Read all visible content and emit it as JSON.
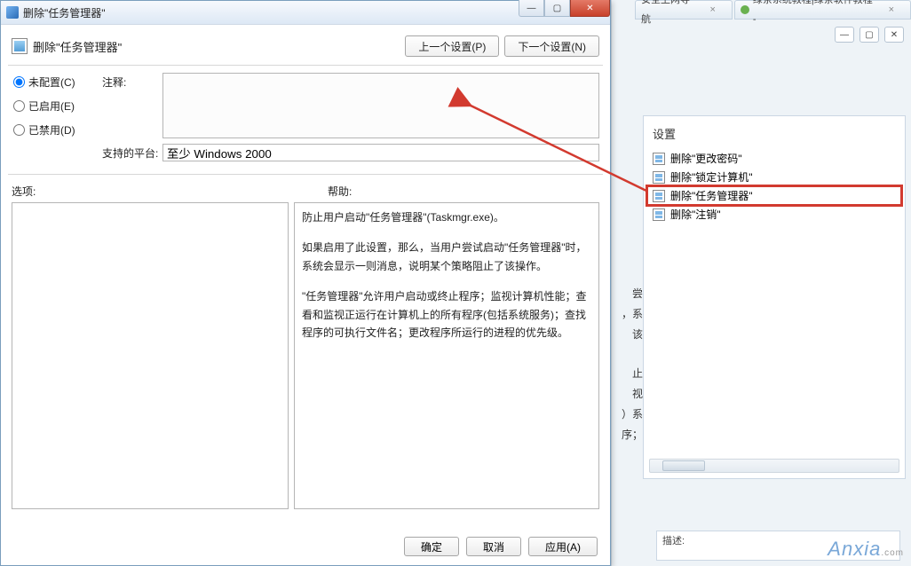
{
  "dialog": {
    "title": "删除\"任务管理器\"",
    "header_title": "删除\"任务管理器\"",
    "nav_prev": "上一个设置(P)",
    "nav_next": "下一个设置(N)",
    "radios": {
      "unconfigured": "未配置(C)",
      "enabled": "已启用(E)",
      "disabled": "已禁用(D)"
    },
    "comment_label": "注释:",
    "comment_value": "",
    "platform_label": "支持的平台:",
    "platform_value": "至少 Windows 2000",
    "options_label": "选项:",
    "help_label": "帮助:",
    "help_body": {
      "p1": "防止用户启动\"任务管理器\"(Taskmgr.exe)。",
      "p2": "如果启用了此设置，那么，当用户尝试启动\"任务管理器\"时，系统会显示一则消息，说明某个策略阻止了该操作。",
      "p3": "\"任务管理器\"允许用户启动或终止程序；监视计算机性能；查看和监视正运行在计算机上的所有程序(包括系统服务)；查找程序的可执行文件名；更改程序所运行的进程的优先级。"
    },
    "footer": {
      "ok": "确定",
      "cancel": "取消",
      "apply": "应用(A)"
    }
  },
  "browser": {
    "tab1": "安全上网导航",
    "tab2": "绿茶系统教程|绿茶软件教程 - "
  },
  "gp": {
    "header": "设置",
    "items": [
      {
        "label": "删除\"更改密码\""
      },
      {
        "label": "删除\"锁定计算机\""
      },
      {
        "label": "删除\"任务管理器\""
      },
      {
        "label": "删除\"注销\""
      }
    ],
    "selected_index": 2
  },
  "snippets": [
    "尝",
    "，系",
    "该",
    "止",
    "视",
    "）系",
    "序；"
  ],
  "desc": {
    "label": "描述:"
  },
  "watermark": {
    "main": "Anxia",
    "suffix": ".com"
  }
}
